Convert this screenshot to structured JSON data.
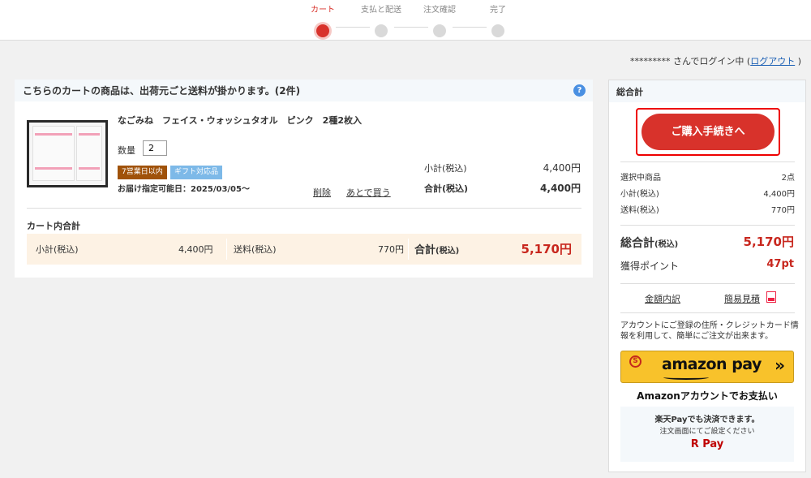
{
  "steps": [
    {
      "label": "カート",
      "active": true
    },
    {
      "label": "支払と配送",
      "active": false
    },
    {
      "label": "注文確認",
      "active": false
    },
    {
      "label": "完了",
      "active": false
    }
  ],
  "login": {
    "user": "********* さんでログイン中 (",
    "logout": "ログアウト",
    "close": " )"
  },
  "cart": {
    "header": "こちらのカートの商品は、出荷元ごと送料が掛かります。(2件)",
    "help": "?",
    "item": {
      "name": "なごみね　フェイス・ウォッシュタオル　ピンク　2種2枚入",
      "qty_label": "数量",
      "qty": "2",
      "badge_ship": "7営業日以内",
      "badge_gift": "ギフト対応品",
      "delivery": "お届け指定可能日：2025/03/05〜",
      "delete": "削除",
      "later": "あとで買う",
      "subtotal_label": "小計(税込)",
      "subtotal": "4,400円",
      "total_label": "合計(税込)",
      "total": "4,400円"
    },
    "summary": {
      "title": "カート内合計",
      "subtotal_label": "小計(税込)",
      "subtotal": "4,400円",
      "shipping_label": "送料(税込)",
      "shipping": "770円",
      "grand_label": "合計",
      "grand_suffix": "(税込)",
      "grand": "5,170円"
    }
  },
  "side": {
    "title": "総合計",
    "cta": "ご購入手続きへ",
    "selected_label": "選択中商品",
    "selected": "2点",
    "subtotal_label": "小計(税込)",
    "subtotal": "4,400円",
    "shipping_label": "送料(税込)",
    "shipping": "770円",
    "grand_label": "総合計",
    "grand_suffix": "(税込)",
    "grand": "5,170円",
    "points_label": "獲得ポイント",
    "points": "47pt",
    "breakdown": "金額内訳",
    "quote": "簡易見積",
    "account_note": "アカウントにご登録の住所・クレジットカード情報を利用して、簡単にご注文が出来ます。",
    "amazon_coin": "S",
    "amazon_brand": "amazon pay",
    "amazon_arrow": "»",
    "amazon_caption": "Amazonアカウントでお支払い",
    "rpay_line1": "楽天Payでも決済できます。",
    "rpay_line2": "注文画面にてご設定ください",
    "rpay_logo": "R Pay"
  },
  "colors": {
    "accent": "#d8322b",
    "price": "#c8271e",
    "ship_badge": "#a0520a",
    "gift_badge": "#7db9e8",
    "amazon": "#f8c22b"
  }
}
